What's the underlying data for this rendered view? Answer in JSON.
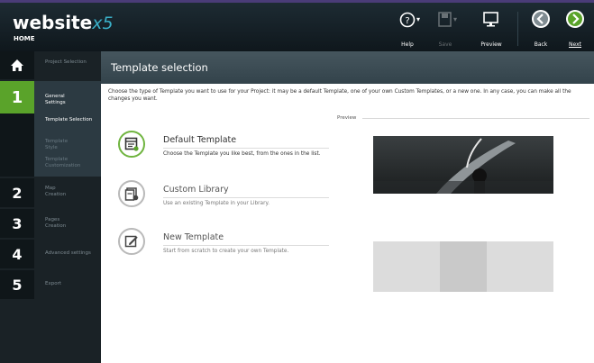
{
  "app": {
    "logo_word": "website",
    "logo_x5": "x5",
    "logo_sub": "HOME"
  },
  "toolbar": {
    "help_label": "Help",
    "save_label": "Save",
    "preview_label": "Preview",
    "back_label": "Back",
    "next_label": "Next"
  },
  "sidebar": {
    "project_selection": "Project Selection",
    "steps": [
      {
        "number": "1",
        "label": "General Settings"
      },
      {
        "number": "2",
        "label": "Map Creation"
      },
      {
        "number": "3",
        "label": "Pages Creation"
      },
      {
        "number": "4",
        "label": "Advanced settings"
      },
      {
        "number": "5",
        "label": "Export"
      }
    ],
    "subitems": [
      {
        "label": "Template Selection"
      },
      {
        "label": "Template Style"
      },
      {
        "label": "Template Customization"
      }
    ]
  },
  "main": {
    "title": "Template selection",
    "intro": "Choose the type of Template you want to use for your Project: it may be a default Template, one of your own Custom Templates, or a new one. In any case, you can make all the changes you want.",
    "options": [
      {
        "title": "Default Template",
        "desc": "Choose the Template you like best, from the ones in the list.",
        "selected": true
      },
      {
        "title": "Custom Library",
        "desc": "Use an existing Template in your Library.",
        "selected": false
      },
      {
        "title": "New Template",
        "desc": "Start from scratch to create your own Template.",
        "selected": false
      }
    ],
    "preview_label": "Preview"
  },
  "colors": {
    "accent_green": "#5aa32a",
    "topbar": "#1d2b33",
    "sidebar": "#1a2226"
  },
  "icons": [
    "help-icon",
    "save-icon",
    "preview-icon",
    "back-icon",
    "next-icon",
    "home-icon",
    "default-template-icon",
    "custom-library-icon",
    "new-template-icon"
  ]
}
